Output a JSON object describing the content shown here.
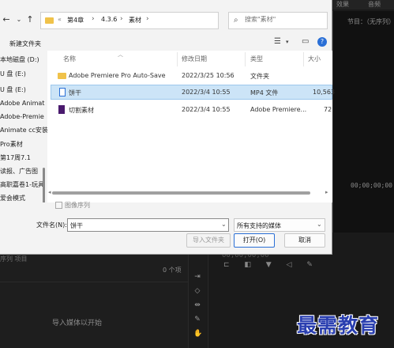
{
  "background": {
    "tabs": [
      "效果",
      "音频"
    ],
    "monitor_title": "节目：（无序列）",
    "timecode": "00;00;00;00",
    "project_tab": "序列 项目",
    "item_count": "0 个项",
    "import_hint": "导入媒体以开始",
    "timeline_tc": "00;00;00;00",
    "watermark": "最需教育"
  },
  "dialog": {
    "breadcrumbs": [
      "«",
      "第4章",
      "4.3.6",
      "素材"
    ],
    "search_placeholder": "搜索\"素材\"",
    "new_folder": "新建文件夹",
    "nav_items": [
      "本地磁盘 (D:)",
      "U 盘 (E:)",
      "U 盘 (E:)",
      "Adobe Animat",
      "Adobe-Premie",
      "Animate cc安装",
      "Pro素材",
      "第17周7.1",
      "读报、广告图",
      "高职嘉卷1-玩具",
      "爱会模式"
    ],
    "columns": [
      "名称",
      "修改日期",
      "类型",
      "大小"
    ],
    "files": [
      {
        "name": "Adobe Premiere Pro Auto-Save",
        "date": "2022/3/25 10:56",
        "type": "文件夹",
        "size": "",
        "icon": "folder-icon"
      },
      {
        "name": "饼干",
        "date": "2022/3/4 10:55",
        "type": "MP4 文件",
        "size": "10,563",
        "icon": "mp4-file-icon"
      },
      {
        "name": "切割素材",
        "date": "2022/3/4 10:55",
        "type": "Adobe Premiere...",
        "size": "72",
        "icon": "premiere-project-icon"
      }
    ],
    "preview_label": "图像序列",
    "filename_label": "文件名(N):",
    "filename_value": "饼干",
    "filetype_value": "所有支持的媒体",
    "import_folder_button": "导入文件夹",
    "open_button": "打开(O)",
    "cancel_button": "取消"
  },
  "colors": {
    "selection": "#cce4f7",
    "accent": "#2a6fd6",
    "folder": "#f0c24a",
    "watermark": "#2a3fb0"
  }
}
